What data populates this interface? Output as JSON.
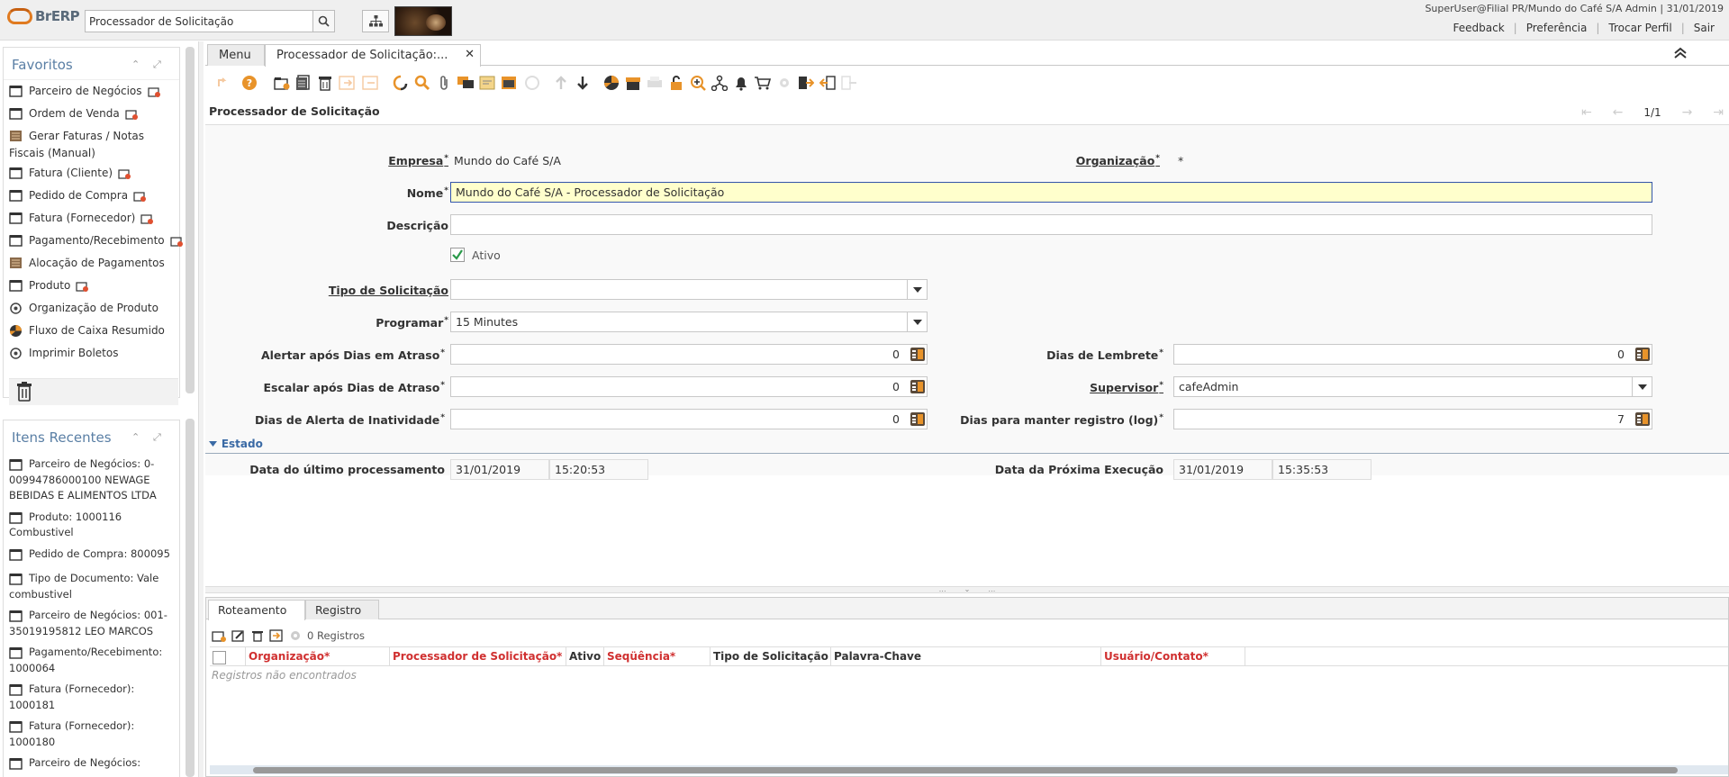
{
  "header": {
    "brand": "BrERP",
    "search_value": "Processador de Solicitação",
    "user_info": "SuperUser@Filial PR/Mundo do Café S/A Admin | 31/01/2019",
    "links": [
      "Feedback",
      "Preferência",
      "Trocar Perfil",
      "Sair"
    ]
  },
  "sidebar": {
    "favorites_title": "Favoritos",
    "favorites": [
      {
        "label": "Parceiro de Negócios",
        "icon": "window-icon",
        "add": true
      },
      {
        "label": "Ordem de Venda",
        "icon": "window-icon",
        "add": true
      },
      {
        "label": "Gerar Faturas / Notas Fiscais (Manual)",
        "icon": "report-icon",
        "add": false
      },
      {
        "label": "Fatura (Cliente)",
        "icon": "window-icon",
        "add": true
      },
      {
        "label": "Pedido de Compra",
        "icon": "window-icon",
        "add": true
      },
      {
        "label": "Fatura (Fornecedor)",
        "icon": "window-icon",
        "add": true
      },
      {
        "label": "Pagamento/Recebimento",
        "icon": "window-icon",
        "add": true
      },
      {
        "label": "Alocação de Pagamentos",
        "icon": "report-icon",
        "add": false
      },
      {
        "label": "Produto",
        "icon": "window-icon",
        "add": true
      },
      {
        "label": "Organização de Produto",
        "icon": "process-icon",
        "add": false
      },
      {
        "label": "Fluxo de Caixa Resumido",
        "icon": "chart-icon",
        "add": false
      },
      {
        "label": "Imprimir Boletos",
        "icon": "process-icon",
        "add": false
      }
    ],
    "recent_title": "Itens Recentes",
    "recent": [
      "Parceiro de Negócios: 0-00994786000100 NEWAGE BEBIDAS E ALIMENTOS LTDA",
      "Produto: 1000116 Combustivel",
      "Pedido de Compra: 800095",
      "Tipo de Documento: Vale combustivel",
      "Parceiro de Negócios: 001-35019195812 LEO MARCOS",
      "Pagamento/Recebimento: 1000064",
      "Fatura (Fornecedor): 1000181",
      "Fatura (Fornecedor): 1000180",
      "Parceiro de Negócios:"
    ]
  },
  "tabs": {
    "menu": "Menu",
    "active": "Processador de Solicitação:..."
  },
  "window": {
    "title": "Processador de Solicitação",
    "record_nav": "1/1"
  },
  "form": {
    "empresa_label": "Empresa",
    "empresa_value": "Mundo do Café S/A",
    "organizacao_label": "Organização",
    "organizacao_value": "*",
    "nome_label": "Nome",
    "nome_value": "Mundo do Café S/A - Processador de Solicitação",
    "descricao_label": "Descrição",
    "descricao_value": "",
    "ativo_label": "Ativo",
    "tipo_label": "Tipo de Solicitação",
    "tipo_value": "",
    "programar_label": "Programar",
    "programar_value": "15 Minutes",
    "alertar_label": "Alertar após Dias em Atraso",
    "alertar_value": "0",
    "lembrete_label": "Dias de Lembrete",
    "lembrete_value": "0",
    "escalar_label": "Escalar após Dias de Atraso",
    "escalar_value": "0",
    "supervisor_label": "Supervisor",
    "supervisor_value": "cafeAdmin",
    "inatividade_label": "Dias de Alerta de Inatividade",
    "inatividade_value": "0",
    "log_label": "Dias para manter registro (log)",
    "log_value": "7",
    "estado_section": "Estado",
    "ultimo_label": "Data do último processamento",
    "ultimo_date": "31/01/2019",
    "ultimo_time": "15:20:53",
    "proxima_label": "Data da Próxima Execução",
    "proxima_date": "31/01/2019",
    "proxima_time": "15:35:53"
  },
  "detail": {
    "tabs": [
      "Roteamento",
      "Registro"
    ],
    "records": "0 Registros",
    "columns": [
      {
        "label": "Organização*",
        "required": true
      },
      {
        "label": "Processador de Solicitação*",
        "required": true
      },
      {
        "label": "Ativo",
        "required": false
      },
      {
        "label": "Seqüência*",
        "required": true
      },
      {
        "label": "Tipo de Solicitação",
        "required": false
      },
      {
        "label": "Palavra-Chave",
        "required": false
      },
      {
        "label": "Usuário/Contato*",
        "required": true
      }
    ],
    "empty_message": "Registros não encontrados"
  },
  "colors": {
    "accent_orange": "#e8932a",
    "required_red": "#d03030",
    "link_blue": "#3a6aa5",
    "highlight_field": "#ffffcc"
  }
}
